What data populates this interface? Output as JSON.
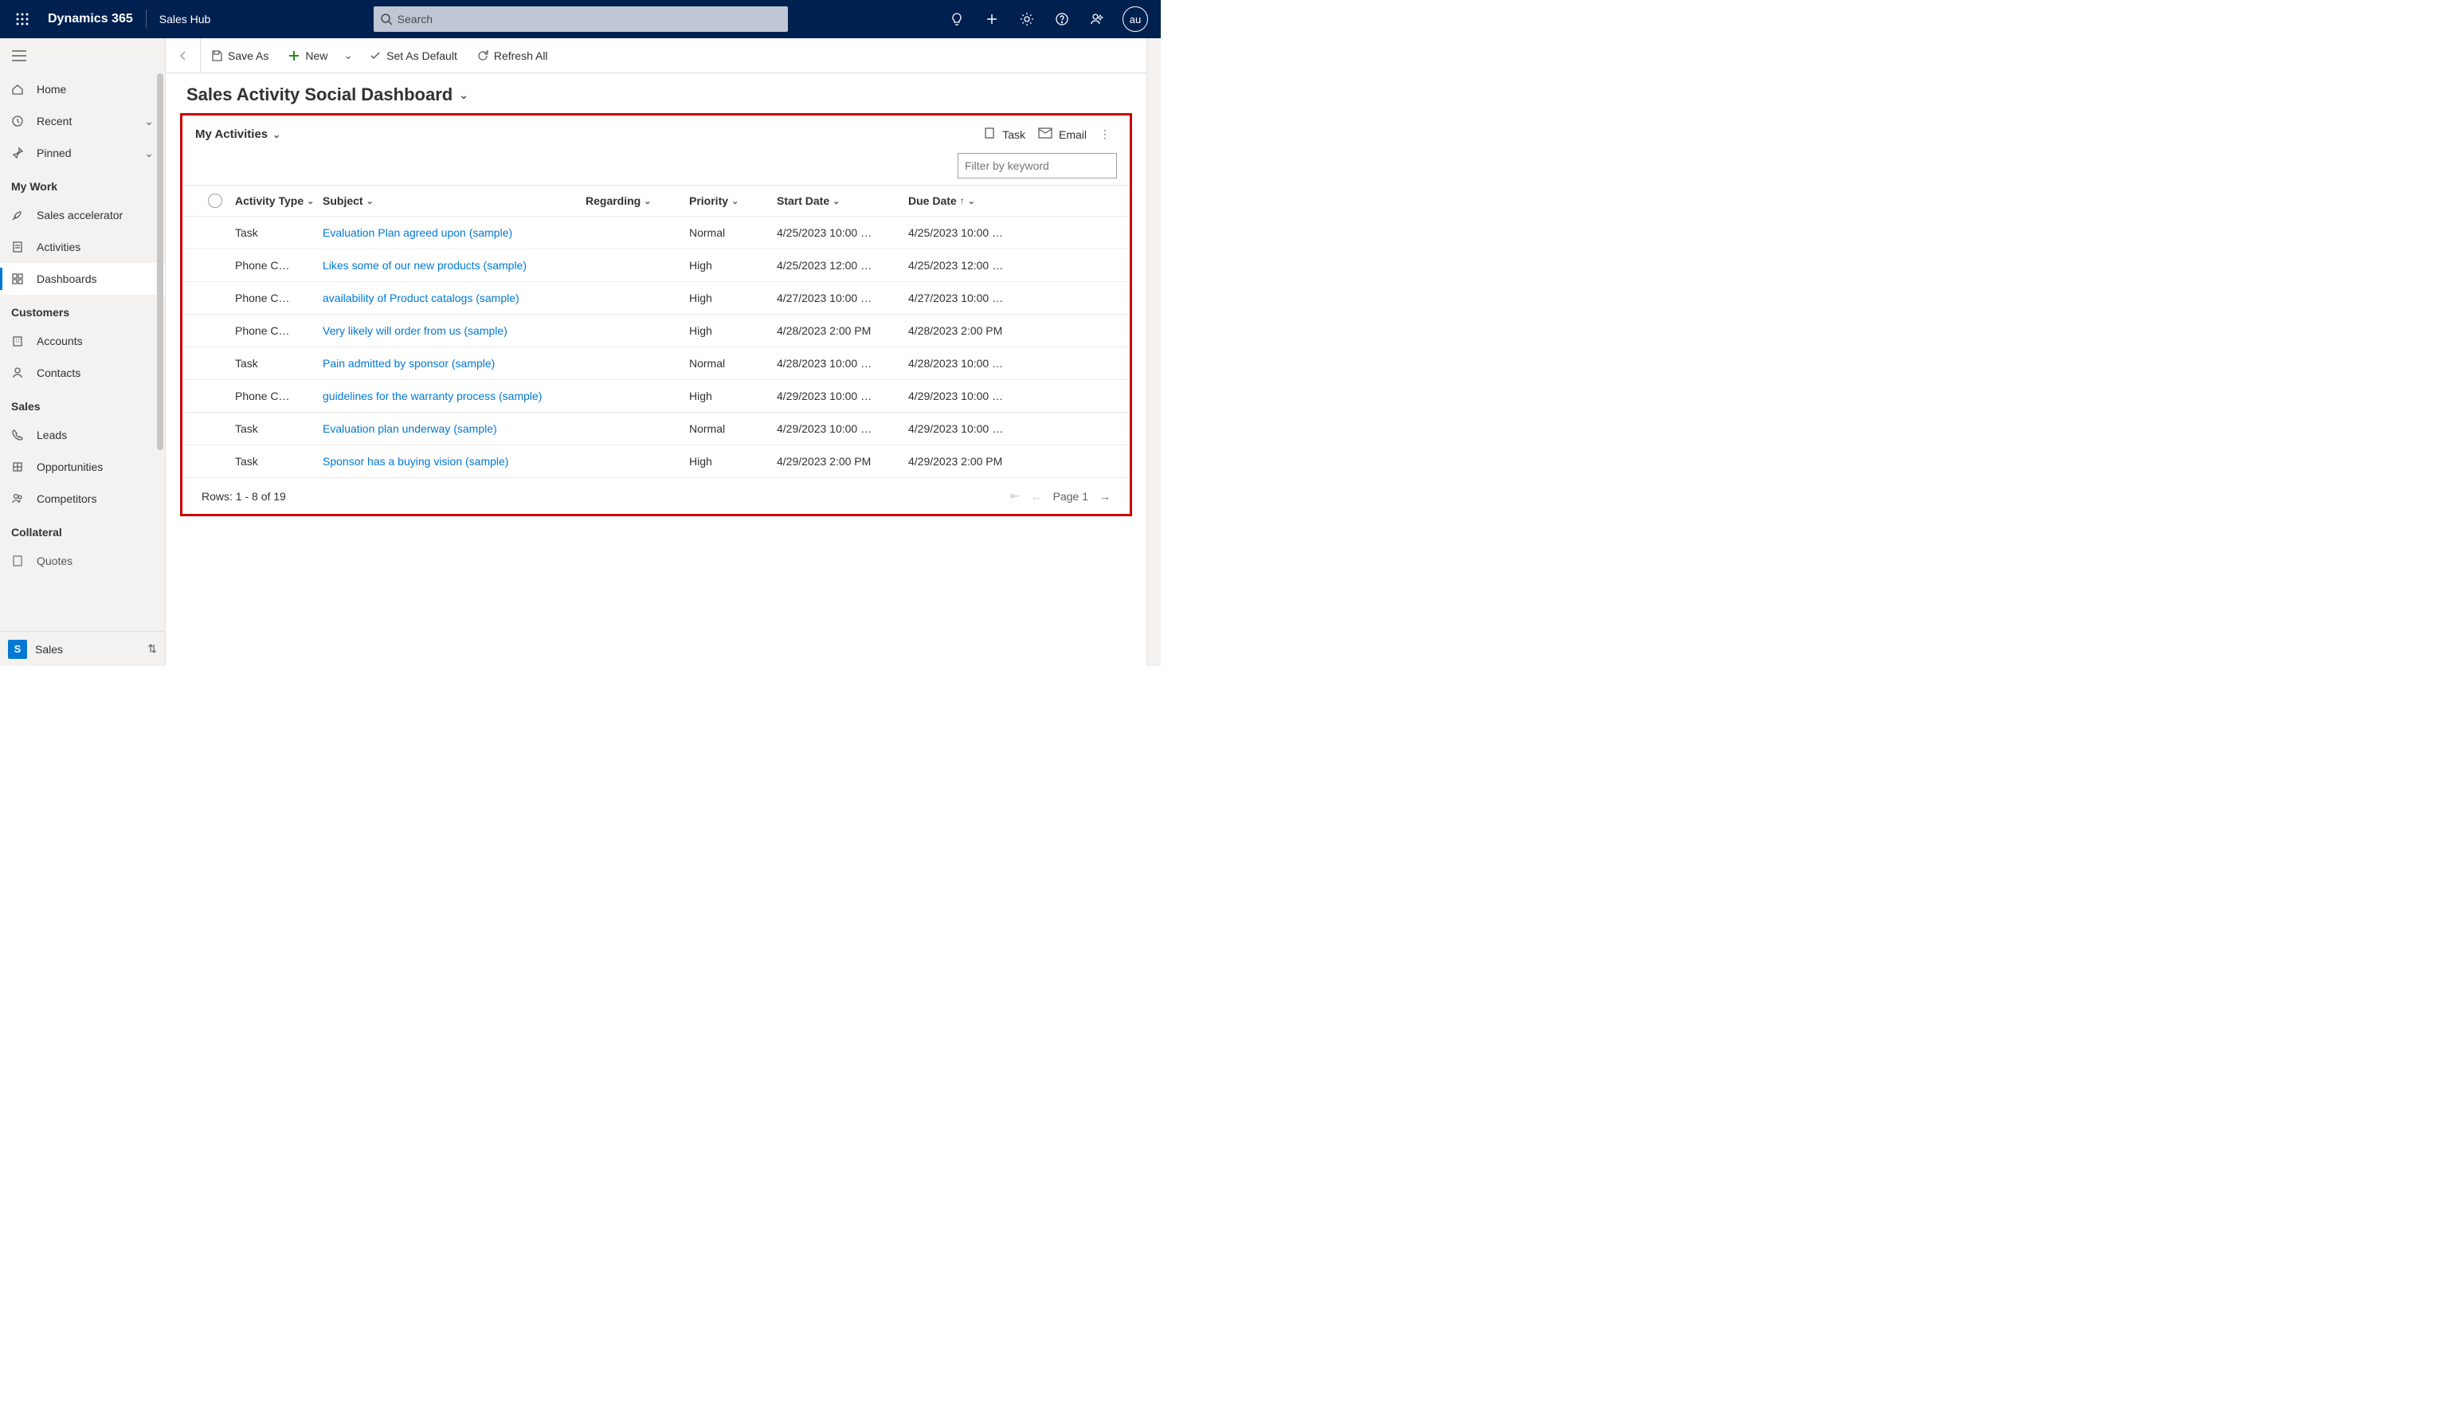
{
  "header": {
    "brand": "Dynamics 365",
    "hub": "Sales Hub",
    "search_placeholder": "Search",
    "avatar": "au"
  },
  "sidebar": {
    "items": {
      "home": "Home",
      "recent": "Recent",
      "pinned": "Pinned",
      "sales_accel": "Sales accelerator",
      "activities": "Activities",
      "dashboards": "Dashboards",
      "accounts": "Accounts",
      "contacts": "Contacts",
      "leads": "Leads",
      "opportunities": "Opportunities",
      "competitors": "Competitors",
      "quotes": "Quotes"
    },
    "sections": {
      "mywork": "My Work",
      "customers": "Customers",
      "sales": "Sales",
      "collateral": "Collateral"
    },
    "footer": {
      "badge": "S",
      "label": "Sales"
    }
  },
  "commandbar": {
    "save_as": "Save As",
    "new": "New",
    "set_default": "Set As Default",
    "refresh_all": "Refresh All"
  },
  "page": {
    "title": "Sales Activity Social Dashboard"
  },
  "panel": {
    "view_label": "My Activities",
    "actions": {
      "task": "Task",
      "email": "Email"
    },
    "filter_placeholder": "Filter by keyword",
    "columns": {
      "activity_type": "Activity Type",
      "subject": "Subject",
      "regarding": "Regarding",
      "priority": "Priority",
      "start_date": "Start Date",
      "due_date": "Due Date"
    },
    "rows": [
      {
        "type": "Task",
        "subject": "Evaluation Plan agreed upon (sample)",
        "priority": "Normal",
        "start": "4/25/2023 10:00 …",
        "due": "4/25/2023 10:00 …"
      },
      {
        "type": "Phone C…",
        "subject": "Likes some of our new products (sample)",
        "priority": "High",
        "start": "4/25/2023 12:00 …",
        "due": "4/25/2023 12:00 …"
      },
      {
        "type": "Phone C…",
        "subject": "availability of Product catalogs (sample)",
        "priority": "High",
        "start": "4/27/2023 10:00 …",
        "due": "4/27/2023 10:00 …"
      },
      {
        "type": "Phone C…",
        "subject": "Very likely will order from us (sample)",
        "priority": "High",
        "start": "4/28/2023 2:00 PM",
        "due": "4/28/2023 2:00 PM"
      },
      {
        "type": "Task",
        "subject": "Pain admitted by sponsor (sample)",
        "priority": "Normal",
        "start": "4/28/2023 10:00 …",
        "due": "4/28/2023 10:00 …"
      },
      {
        "type": "Phone C…",
        "subject": "guidelines for the warranty process (sample)",
        "priority": "High",
        "start": "4/29/2023 10:00 …",
        "due": "4/29/2023 10:00 …"
      },
      {
        "type": "Task",
        "subject": "Evaluation plan underway (sample)",
        "priority": "Normal",
        "start": "4/29/2023 10:00 …",
        "due": "4/29/2023 10:00 …"
      },
      {
        "type": "Task",
        "subject": "Sponsor has a buying vision (sample)",
        "priority": "High",
        "start": "4/29/2023 2:00 PM",
        "due": "4/29/2023 2:00 PM"
      }
    ],
    "footer": {
      "rows_text": "Rows: 1 - 8 of 19",
      "page_text": "Page 1"
    }
  }
}
